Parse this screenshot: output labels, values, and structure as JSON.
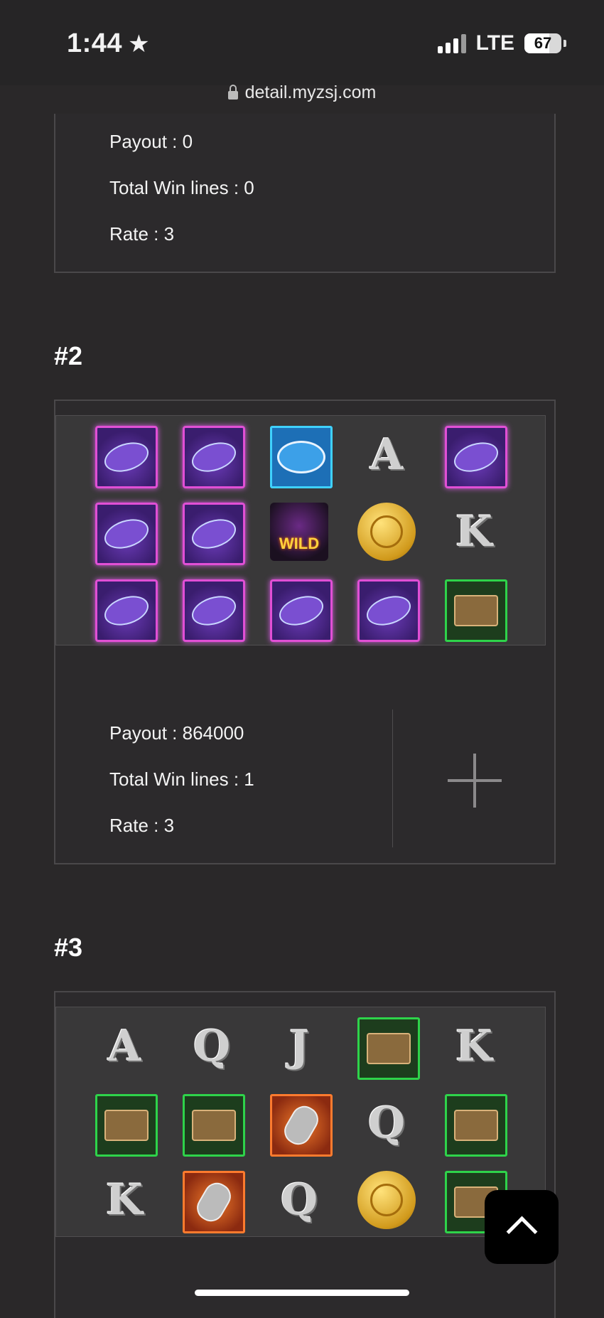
{
  "status_bar": {
    "time": "1:44",
    "carrier": "LTE",
    "battery": "67",
    "battery_level": 0.67
  },
  "browser": {
    "url": "detail.myzsj.com"
  },
  "round1": {
    "payout": "Payout : 0",
    "win_lines": "Total Win lines : 0",
    "rate": "Rate : 3"
  },
  "round2": {
    "heading": "#2",
    "grid": [
      [
        "guitar",
        "guitar",
        "drum",
        "A",
        "guitar"
      ],
      [
        "guitar",
        "guitar",
        "wild",
        "coin",
        "K"
      ],
      [
        "guitar",
        "guitar",
        "guitar",
        "guitar",
        "boombox"
      ]
    ],
    "wild_label": "WILD",
    "payout": "Payout : 864000",
    "win_lines": "Total Win lines : 1",
    "rate": "Rate : 3"
  },
  "round3": {
    "heading": "#3",
    "grid": [
      [
        "A",
        "Q",
        "J",
        "boombox",
        "K"
      ],
      [
        "boombox",
        "boombox",
        "mic",
        "Q",
        "boombox"
      ],
      [
        "K",
        "mic",
        "Q",
        "coin",
        "boombox"
      ]
    ]
  }
}
